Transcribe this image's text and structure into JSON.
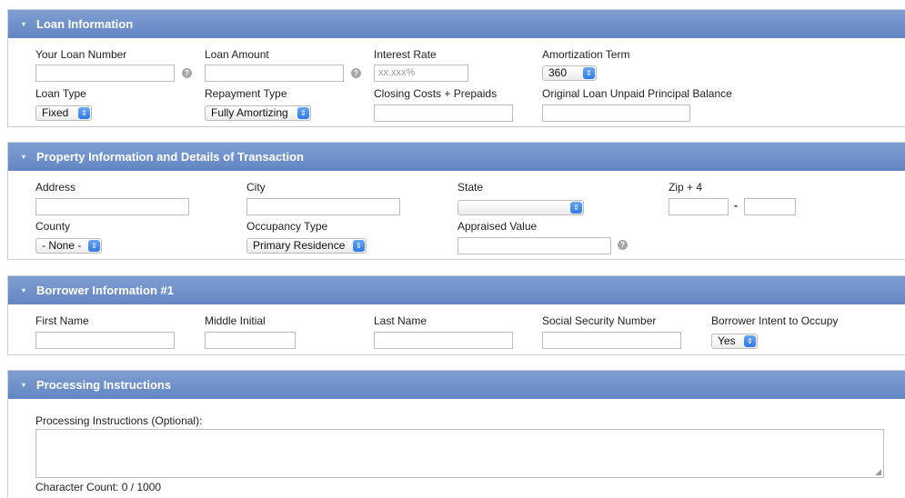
{
  "loan": {
    "title": "Loan Information",
    "your_loan_number": "Your Loan Number",
    "loan_amount": "Loan Amount",
    "interest_rate": "Interest Rate",
    "interest_rate_placeholder": "xx.xxx%",
    "amortization_term": "Amortization Term",
    "amortization_value": "360",
    "loan_type": "Loan Type",
    "loan_type_value": "Fixed",
    "repayment_type": "Repayment Type",
    "repayment_value": "Fully Amortizing",
    "closing_costs": "Closing Costs + Prepaids",
    "original_upb": "Original Loan Unpaid Principal Balance"
  },
  "property": {
    "title": "Property Information and Details of Transaction",
    "address": "Address",
    "city": "City",
    "state": "State",
    "state_value": "",
    "zip": "Zip + 4",
    "zip_sep": "-",
    "county": "County",
    "county_value": "- None -",
    "occupancy_type": "Occupancy Type",
    "occupancy_value": "Primary Residence",
    "appraised_value": "Appraised Value"
  },
  "borrower": {
    "title": "Borrower Information #1",
    "first_name": "First Name",
    "middle_initial": "Middle Initial",
    "last_name": "Last Name",
    "ssn": "Social Security Number",
    "intent": "Borrower Intent to Occupy",
    "intent_value": "Yes"
  },
  "processing": {
    "title": "Processing Instructions",
    "label": "Processing Instructions (Optional):",
    "char_count": "Character Count: 0 / 1000"
  },
  "icons": {
    "help": "?",
    "chevron": "▾",
    "select_arrow": "⇕",
    "grip": "◢"
  }
}
